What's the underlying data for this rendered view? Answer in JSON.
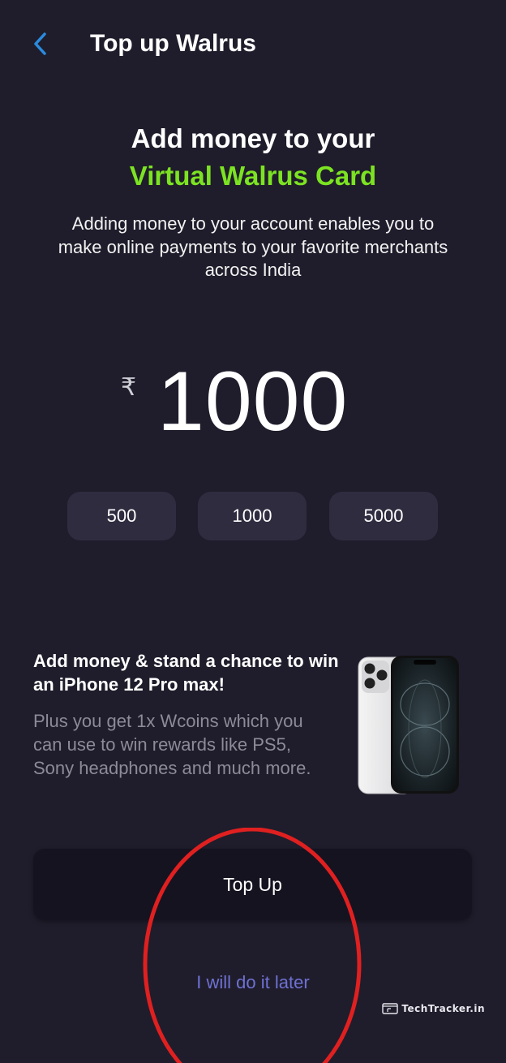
{
  "header": {
    "back_icon": "chevron-left-icon",
    "title": "Top up Walrus"
  },
  "hero": {
    "line1": "Add money to your",
    "line2": "Virtual Walrus Card",
    "accent_color": "#7ce322",
    "description": "Adding money to your account enables you to make online payments to your favorite merchants across India"
  },
  "amount": {
    "currency_symbol": "₹",
    "value": "1000"
  },
  "quick_amounts": [
    "500",
    "1000",
    "5000"
  ],
  "promo": {
    "title": "Add money & stand a chance to win an iPhone 12 Pro max!",
    "description": "Plus you get 1x Wcoins which you can use to win rewards like PS5, Sony headphones and much more.",
    "image": "iphone-12-pro-max-image"
  },
  "actions": {
    "topup_label": "Top Up",
    "later_label": "I will do it later",
    "link_color": "#6f71d4"
  },
  "annotation": {
    "shape": "red-oval",
    "color": "#e02020"
  },
  "watermark": {
    "text": "TechTracker.in"
  },
  "colors": {
    "background": "#1f1d2b",
    "chip_background": "#2f2c40",
    "button_background": "#151320"
  }
}
